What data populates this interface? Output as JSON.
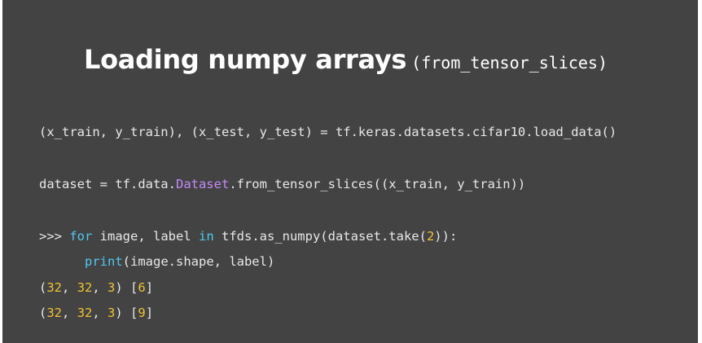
{
  "slide": {
    "title": "Loading numpy arrays",
    "title_suffix": "(from_tensor_slices)",
    "colors": {
      "background": "#434343",
      "text": "#e8e8e8",
      "keyword": "#4ec9f0",
      "class": "#c58af9",
      "number": "#f1c232"
    }
  },
  "code": {
    "line1": "(x_train, y_train), (x_test, y_test) = tf.keras.datasets.cifar10.load_data()",
    "line2": {
      "pre": "dataset = tf.data.",
      "cls": "Dataset",
      "post": ".from_tensor_slices((x_train, y_train))"
    },
    "line3": {
      "prompt": ">>> ",
      "kw_for": "for",
      "mid1": " image, label ",
      "kw_in": "in",
      "mid2": " tfds.as_numpy(dataset.take(",
      "num": "2",
      "end": ")):"
    },
    "line4": {
      "indent": "      ",
      "kw_print": "print",
      "rest": "(image.shape, label)"
    },
    "output1": {
      "open": "(",
      "n1": "32",
      "sep1": ", ",
      "n2": "32",
      "sep2": ", ",
      "n3": "3",
      "close": ") [",
      "label": "6",
      "end": "]"
    },
    "output2": {
      "open": "(",
      "n1": "32",
      "sep1": ", ",
      "n2": "32",
      "sep2": ", ",
      "n3": "3",
      "close": ") [",
      "label": "9",
      "end": "]"
    }
  }
}
